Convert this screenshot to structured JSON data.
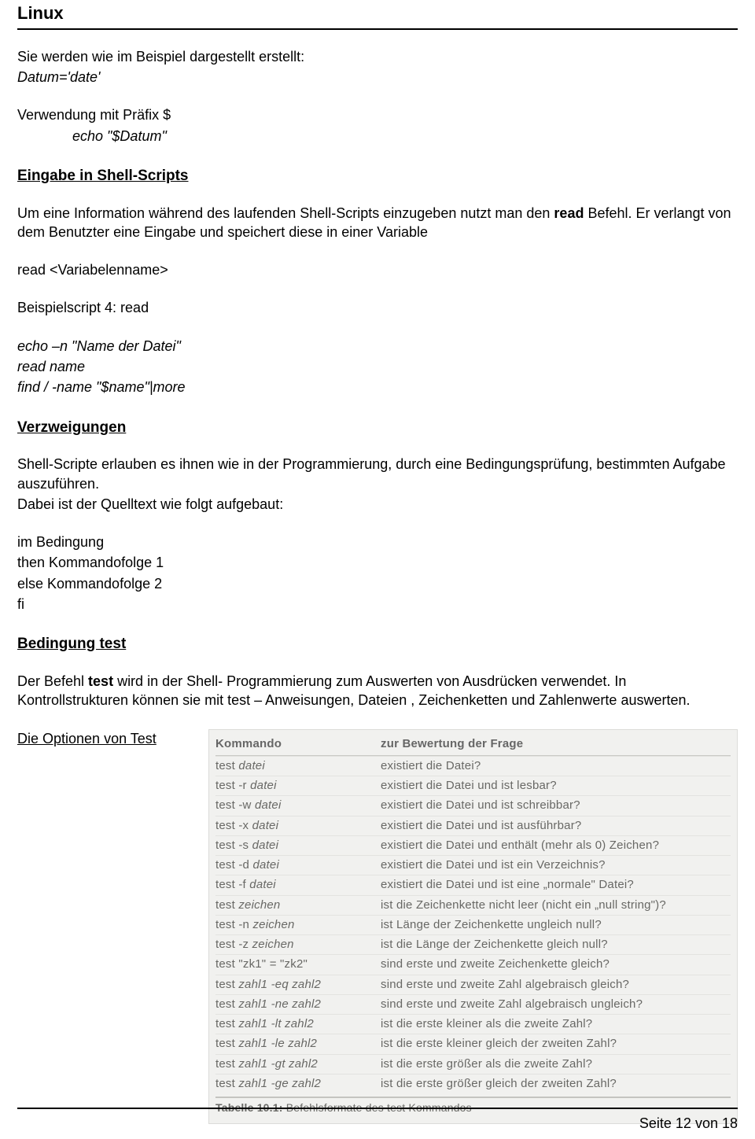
{
  "header": "Linux",
  "para1": "Sie werden wie im Beispiel dargestellt erstellt:",
  "para1_code": "Datum='date'",
  "para2": "Verwendung mit Präfix $",
  "para2_code": "echo \"$Datum\"",
  "h_eingabe": "Eingabe in Shell-Scripts",
  "eingabe_p1_a": "Um eine Information während des laufenden Shell-Scripts einzugeben nutzt man den ",
  "eingabe_p1_b": "read",
  "eingabe_p1_c": " Befehl. Er verlangt von dem Benutzter eine Eingabe und speichert diese in einer Variable",
  "eingabe_p2": "read  <Variabelenname>",
  "eingabe_p3": "Beispielscript 4: read",
  "eingabe_code1": "echo –n  \"Name der Datei\"",
  "eingabe_code2": "read name",
  "eingabe_code3": "find / -name \"$name\"|more",
  "h_verz": "Verzweigungen",
  "verz_p1": "Shell-Scripte erlauben es ihnen wie in der Programmierung, durch eine Bedingungsprüfung, bestimmten Aufgabe auszuführen.",
  "verz_p2": "Dabei ist der Quelltext wie folgt aufgebaut:",
  "verz_c1": "im Bedingung",
  "verz_c2": "then Kommandofolge 1",
  "verz_c3": "else  Kommandofolge 2",
  "verz_c4": "fi",
  "h_bed": "Bedingung test",
  "bed_p1_a": "Der Befehl ",
  "bed_p1_b": "test",
  "bed_p1_c": " wird in der Shell- Programmierung zum Auswerten von Ausdrücken verwendet. In Kontrollstrukturen können sie mit test – Anweisungen, Dateien , Zeichenketten und Zahlenwerte auswerten.",
  "options_label": "Die Optionen von Test",
  "table": {
    "head1": "Kommando",
    "head2": "zur Bewertung der Frage",
    "rows": [
      {
        "cmd_pre": "test ",
        "arg": "datei",
        "desc": "existiert die Datei?"
      },
      {
        "cmd_pre": "test -r ",
        "arg": "datei",
        "desc": "existiert die Datei und ist lesbar?"
      },
      {
        "cmd_pre": "test -w ",
        "arg": "datei",
        "desc": "existiert die Datei und ist schreibbar?"
      },
      {
        "cmd_pre": "test -x ",
        "arg": "datei",
        "desc": "existiert die Datei und ist ausführbar?"
      },
      {
        "cmd_pre": "test -s ",
        "arg": "datei",
        "desc": "existiert die Datei und enthält (mehr als 0) Zeichen?"
      },
      {
        "cmd_pre": "test -d ",
        "arg": "datei",
        "desc": "existiert die Datei und ist ein Verzeichnis?"
      },
      {
        "cmd_pre": "test -f ",
        "arg": "datei",
        "desc": "existiert die Datei und ist eine „normale\" Datei?"
      },
      {
        "cmd_pre": "test ",
        "arg": "zeichen",
        "desc": "ist die Zeichenkette nicht leer (nicht ein „null string\")?"
      },
      {
        "cmd_pre": "test -n ",
        "arg": "zeichen",
        "desc": "ist Länge der Zeichenkette ungleich null?"
      },
      {
        "cmd_pre": "test -z ",
        "arg": "zeichen",
        "desc": "ist die Länge der Zeichenkette gleich null?"
      },
      {
        "cmd_pre": "test \"zk1\" = \"zk2\"",
        "arg": "",
        "desc": "sind erste und zweite Zeichenkette gleich?"
      },
      {
        "cmd_pre": "test ",
        "arg": "zahl1 -eq zahl2",
        "desc": "sind erste und zweite Zahl algebraisch gleich?"
      },
      {
        "cmd_pre": "test ",
        "arg": "zahl1 -ne zahl2",
        "desc": "sind erste und zweite Zahl algebraisch ungleich?"
      },
      {
        "cmd_pre": "test ",
        "arg": "zahl1 -lt zahl2",
        "desc": "ist die erste kleiner als die zweite Zahl?"
      },
      {
        "cmd_pre": "test ",
        "arg": "zahl1 -le zahl2",
        "desc": "ist die erste kleiner gleich der zweiten Zahl?"
      },
      {
        "cmd_pre": "test ",
        "arg": "zahl1 -gt zahl2",
        "desc": "ist die erste größer als die zweite Zahl?"
      },
      {
        "cmd_pre": "test ",
        "arg": "zahl1 -ge zahl2",
        "desc": "ist die erste größer gleich der zweiten Zahl?"
      }
    ],
    "caption_lbl": "Tabelle 10.1: ",
    "caption_txt": "Befehlsformate des test Kommandos"
  },
  "footer": "Seite 12 von 18"
}
